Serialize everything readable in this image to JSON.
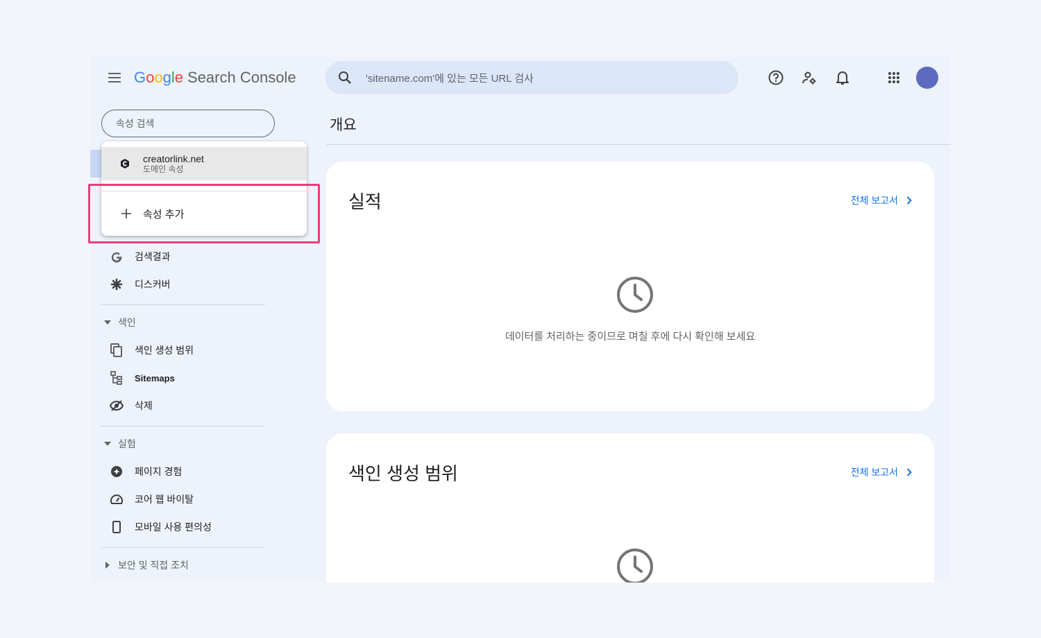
{
  "header": {
    "logo_google": [
      "G",
      "o",
      "o",
      "g",
      "l",
      "e"
    ],
    "logo_product": "Search Console",
    "search_placeholder": "'sitename.com'에 있는 모든 URL 검사"
  },
  "sidebar": {
    "property_search_placeholder": "속성 검색",
    "items_top": [
      {
        "label": "검색결과",
        "icon": "google-g-icon"
      },
      {
        "label": "디스커버",
        "icon": "asterisk-icon"
      }
    ],
    "section_index": {
      "label": "색인",
      "items": [
        {
          "label": "색인 생성 범위",
          "icon": "copy-pages-icon"
        },
        {
          "label": "Sitemaps",
          "icon": "sitemap-icon"
        },
        {
          "label": "삭제",
          "icon": "eye-off-icon"
        }
      ]
    },
    "section_experience": {
      "label": "실험",
      "items": [
        {
          "label": "페이지 경험",
          "icon": "plus-circle-icon"
        },
        {
          "label": "코어 웹 바이탈",
          "icon": "speedometer-icon"
        },
        {
          "label": "모바일 사용 편의성",
          "icon": "phone-icon"
        }
      ]
    },
    "section_security": {
      "label": "보안 및 직접 조치"
    }
  },
  "dropdown": {
    "property_name": "creatorlink.net",
    "property_type": "도메인 속성",
    "add_property": "속성 추가"
  },
  "main": {
    "page_title": "개요",
    "cards": [
      {
        "title": "실적",
        "link": "전체 보고서",
        "message": "데이터를 처리하는 중이므로 며칠 후에 다시 확인해 보세요"
      },
      {
        "title": "색인 생성 범위",
        "link": "전체 보고서"
      }
    ]
  },
  "colors": {
    "highlight": "#ec3d7b",
    "link": "#1a73e8",
    "avatar": "#5c6bc0",
    "search_bg": "#dbe6f8"
  }
}
